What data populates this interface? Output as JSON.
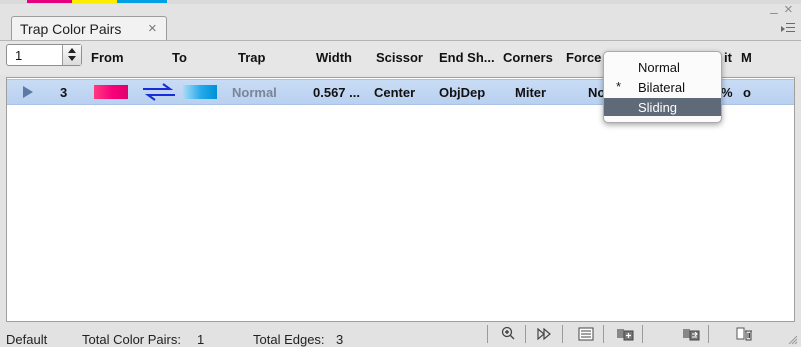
{
  "colors": {
    "selection_row": "#b9d0f0",
    "menu_highlight": "#5f6a79",
    "from_swatch": "#f7007a",
    "to_swatch": "#22a7ea",
    "trap_arrows": "#1a2cd8",
    "top_strip": [
      "#e6007e",
      "#ffed00",
      "#00a0e3"
    ]
  },
  "tab": {
    "label": "Trap Color Pairs",
    "close_icon": "close-icon"
  },
  "toolbar": {
    "count_value": "1"
  },
  "columns": [
    "From",
    "To",
    "Trap",
    "Width",
    "Scissor",
    "End Sh...",
    "Corners",
    "Force",
    "it",
    "M"
  ],
  "rows": [
    {
      "count": "3",
      "trap": "Normal",
      "width": "0.567 ...",
      "scissor": "Center",
      "end_shape": "ObjDep",
      "corners": "Miter",
      "force_partial": "No",
      "limit_partial": "%",
      "m_partial": "o"
    }
  ],
  "popup_menu": {
    "options": [
      "Normal",
      "Bilateral",
      "Sliding"
    ],
    "checked_index": 1,
    "check_mark": "*",
    "highlighted_index": 2
  },
  "footer": {
    "preset": "Default",
    "total_pairs_label": "Total Color Pairs:",
    "total_pairs_value": "1",
    "total_edges_label": "Total Edges:",
    "total_edges_value": "3",
    "icons": [
      "zoom-in-icon",
      "play-forward-icon",
      "list-view-icon",
      "new-pair-icon",
      "swap-icon",
      "delete-icon"
    ]
  }
}
